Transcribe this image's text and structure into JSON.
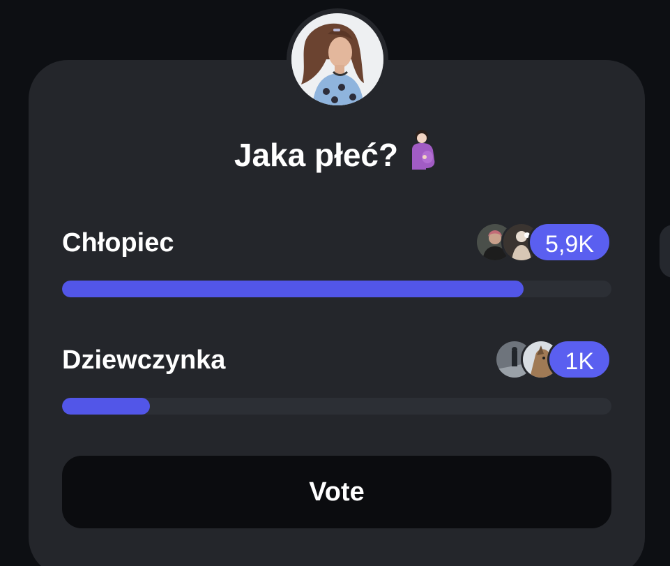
{
  "poll": {
    "question": "Jaka płeć?",
    "question_emoji": "pregnant-woman-emoji",
    "creator_avatar": "creator-avatar-photo",
    "options": [
      {
        "label": "Chłopiec",
        "count": "5,9K",
        "fill_percent": 84,
        "voter_avatars": [
          "voter-photo-1",
          "voter-photo-2"
        ]
      },
      {
        "label": "Dziewczynka",
        "count": "1K",
        "fill_percent": 16,
        "voter_avatars": [
          "voter-photo-3",
          "voter-photo-4"
        ]
      }
    ],
    "vote_label": "Vote"
  },
  "colors": {
    "background": "#0d0f13",
    "card": "#24262b",
    "accent": "#5256e8",
    "track": "#2c2f35",
    "button": "#0b0c0f",
    "text": "#ffffff"
  }
}
